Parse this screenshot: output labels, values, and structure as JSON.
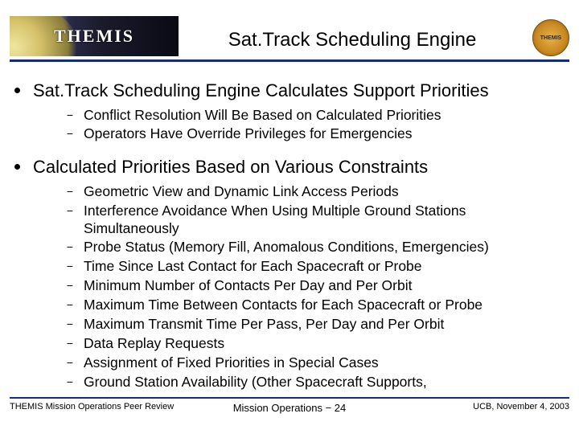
{
  "header": {
    "logo_text": "THEMIS",
    "title": "Sat.Track Scheduling Engine",
    "patch_label": "THEMIS"
  },
  "bullets": [
    {
      "text": "Sat.Track Scheduling Engine Calculates Support Priorities",
      "subs": [
        "Conflict Resolution Will Be Based on Calculated Priorities",
        "Operators Have Override Privileges for Emergencies"
      ]
    },
    {
      "text": "Calculated Priorities Based on Various Constraints",
      "subs": [
        "Geometric View and  Dynamic Link Access Periods",
        "Interference Avoidance When Using Multiple Ground Stations Simultaneously",
        "Probe Status (Memory Fill, Anomalous Conditions, Emergencies)",
        "Time Since Last Contact for Each Spacecraft or Probe",
        "Minimum Number of Contacts Per Day and Per Orbit",
        "Maximum Time Between Contacts for Each Spacecraft or Probe",
        "Maximum Transmit Time Per Pass, Per Day and Per Orbit",
        "Data Replay Requests",
        "Assignment of Fixed Priorities in Special Cases",
        "Ground Station Availability (Other Spacecraft Supports,"
      ]
    }
  ],
  "footer": {
    "left": "THEMIS Mission Operations Peer Review",
    "center": "Mission Operations − 24",
    "right": "UCB, November 4, 2003"
  }
}
